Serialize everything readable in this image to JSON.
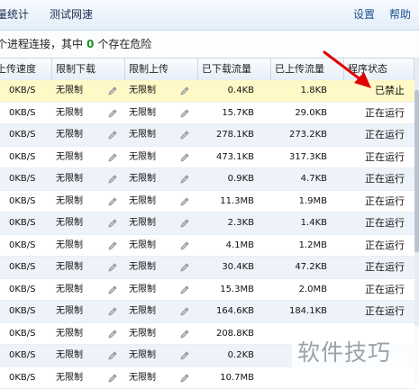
{
  "topbar": {
    "tab_stats": "量统计",
    "tab_speedtest": "测试网速",
    "settings": "设置",
    "help": "帮助"
  },
  "summary": {
    "prefix": "个进程连接，其中",
    "count": "0",
    "suffix": "个存在危险"
  },
  "table": {
    "columns": [
      "上传速度",
      "限制下载",
      "限制上传",
      "已下载流量",
      "已上传流量",
      "程序状态"
    ],
    "rows": [
      {
        "up_speed": "0KB/S",
        "limit_down": "无限制",
        "limit_up": "无限制",
        "downloaded": "0.4KB",
        "uploaded": "1.8KB",
        "status": "已禁止"
      },
      {
        "up_speed": "0KB/S",
        "limit_down": "无限制",
        "limit_up": "无限制",
        "downloaded": "15.7KB",
        "uploaded": "29.0KB",
        "status": "正在运行"
      },
      {
        "up_speed": "0KB/S",
        "limit_down": "无限制",
        "limit_up": "无限制",
        "downloaded": "278.1KB",
        "uploaded": "273.2KB",
        "status": "正在运行"
      },
      {
        "up_speed": "0KB/S",
        "limit_down": "无限制",
        "limit_up": "无限制",
        "downloaded": "473.1KB",
        "uploaded": "317.3KB",
        "status": "正在运行"
      },
      {
        "up_speed": "0KB/S",
        "limit_down": "无限制",
        "limit_up": "无限制",
        "downloaded": "0.9KB",
        "uploaded": "4.7KB",
        "status": "正在运行"
      },
      {
        "up_speed": "0KB/S",
        "limit_down": "无限制",
        "limit_up": "无限制",
        "downloaded": "11.3MB",
        "uploaded": "1.9MB",
        "status": "正在运行"
      },
      {
        "up_speed": "0KB/S",
        "limit_down": "无限制",
        "limit_up": "无限制",
        "downloaded": "2.3KB",
        "uploaded": "1.4KB",
        "status": "正在运行"
      },
      {
        "up_speed": "0KB/S",
        "limit_down": "无限制",
        "limit_up": "无限制",
        "downloaded": "4.1MB",
        "uploaded": "1.2MB",
        "status": "正在运行"
      },
      {
        "up_speed": "0KB/S",
        "limit_down": "无限制",
        "limit_up": "无限制",
        "downloaded": "30.4KB",
        "uploaded": "47.2KB",
        "status": "正在运行"
      },
      {
        "up_speed": "0KB/S",
        "limit_down": "无限制",
        "limit_up": "无限制",
        "downloaded": "15.3MB",
        "uploaded": "2.0MB",
        "status": "正在运行"
      },
      {
        "up_speed": "0KB/S",
        "limit_down": "无限制",
        "limit_up": "无限制",
        "downloaded": "164.6KB",
        "uploaded": "184.1KB",
        "status": "正在运行"
      },
      {
        "up_speed": "0KB/S",
        "limit_down": "无限制",
        "limit_up": "无限制",
        "downloaded": "208.8KB",
        "uploaded": "",
        "status": ""
      },
      {
        "up_speed": "0KB/S",
        "limit_down": "无限制",
        "limit_up": "无限制",
        "downloaded": "0.2KB",
        "uploaded": "",
        "status": ""
      },
      {
        "up_speed": "0KB/S",
        "limit_down": "无限制",
        "limit_up": "无限制",
        "downloaded": "10.7MB",
        "uploaded": "",
        "status": ""
      }
    ]
  },
  "watermark": "软件技巧",
  "colors": {
    "link": "#1e4f8f",
    "danger_count": "#1a8f1a",
    "selected_row": "#fff9c8",
    "alt_row": "#eef3fa",
    "annotation_arrow": "#e00000"
  },
  "icons": {
    "edit_limit": "pencil-icon",
    "annotation": "red-arrow-icon"
  }
}
